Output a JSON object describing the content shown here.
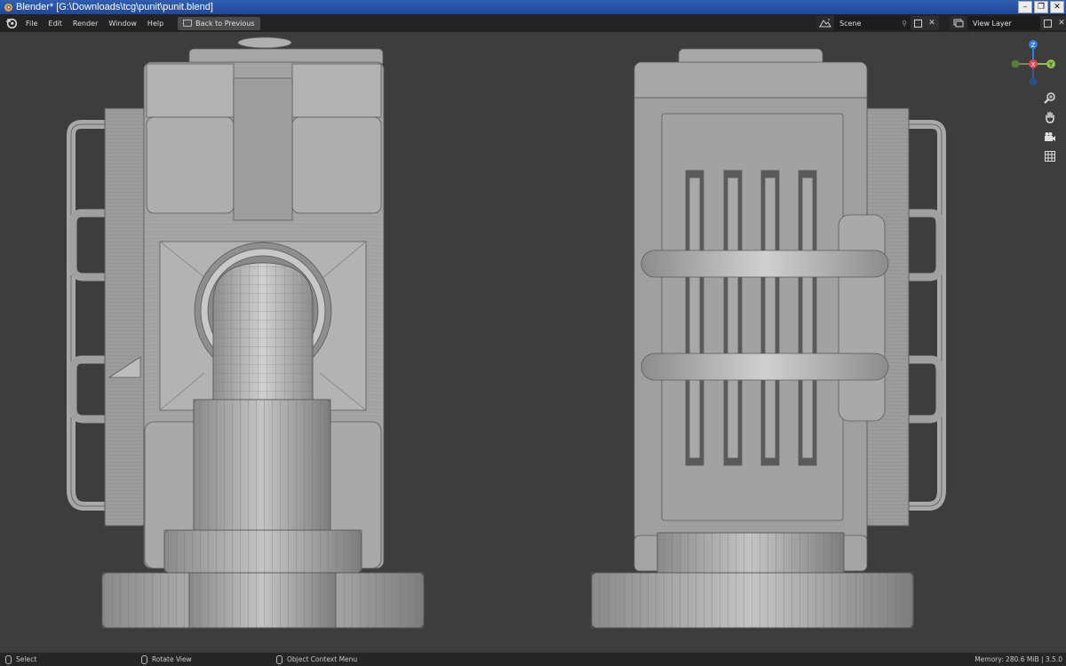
{
  "window": {
    "title": "Blender* [G:\\Downloads\\tcg\\punit\\punit.blend]",
    "minimize": "–",
    "maximize": "❐",
    "close": "✕"
  },
  "menu": {
    "items": [
      {
        "name": "menu-file",
        "label": "File"
      },
      {
        "name": "menu-edit",
        "label": "Edit"
      },
      {
        "name": "menu-render",
        "label": "Render"
      },
      {
        "name": "menu-window",
        "label": "Window"
      },
      {
        "name": "menu-help",
        "label": "Help"
      }
    ],
    "back_label": "Back to Previous"
  },
  "scene": {
    "value": "Scene",
    "icon": "scene-icon"
  },
  "view_layer": {
    "value": "View Layer",
    "icon": "view-layer-icon"
  },
  "gizmo": {
    "z": "Z",
    "x": "X",
    "y": "Y"
  },
  "status": {
    "select": "Select",
    "rotate": "Rotate View",
    "context": "Object Context Menu",
    "memory": "Memory: 280.6 MiB | 3.5.0"
  },
  "colors": {
    "accent": "#2f5fb0",
    "axis_x": "#e84452",
    "axis_y": "#8bc34a",
    "axis_z": "#2f7fe0",
    "mesh": "#9d9d9d"
  }
}
